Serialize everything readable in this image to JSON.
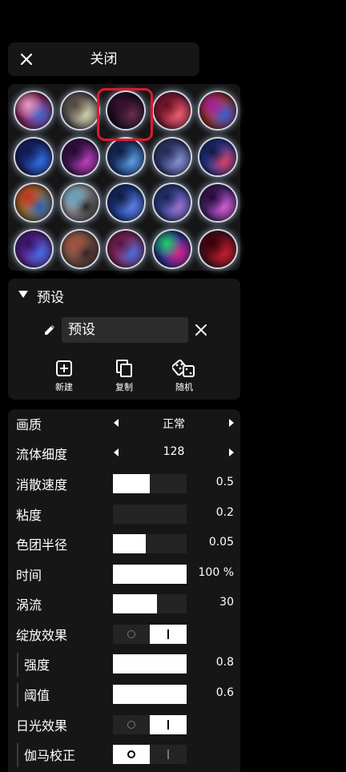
{
  "header": {
    "close_label": "关闭"
  },
  "presets": {
    "selected_index": 2,
    "items": [
      {
        "colors": [
          "#d03080",
          "#3a6ad0",
          "#e0a0c0"
        ]
      },
      {
        "colors": [
          "#8a8070",
          "#d0d0b0",
          "#504840"
        ]
      },
      {
        "colors": [
          "#1a0a18",
          "#6a3050",
          "#3a1030"
        ]
      },
      {
        "colors": [
          "#c02848",
          "#e86070",
          "#601020"
        ]
      },
      {
        "colors": [
          "#e04020",
          "#3060e0",
          "#a020a0"
        ]
      },
      {
        "colors": [
          "#203090",
          "#3070e0",
          "#101850"
        ]
      },
      {
        "colors": [
          "#602070",
          "#c040c0",
          "#200830"
        ]
      },
      {
        "colors": [
          "#2050a0",
          "#60a0e0",
          "#101838"
        ]
      },
      {
        "colors": [
          "#4858a0",
          "#8890d0",
          "#202850"
        ]
      },
      {
        "colors": [
          "#3050d0",
          "#e04060",
          "#101840"
        ]
      },
      {
        "colors": [
          "#e0a030",
          "#2060c0",
          "#c03020"
        ]
      },
      {
        "colors": [
          "#e0e0e0",
          "#202020",
          "#60a0c0"
        ]
      },
      {
        "colors": [
          "#2050c0",
          "#6080e0",
          "#101838"
        ]
      },
      {
        "colors": [
          "#4060c0",
          "#a070d0",
          "#182050"
        ]
      },
      {
        "colors": [
          "#7030a0",
          "#d060d0",
          "#200830"
        ]
      },
      {
        "colors": [
          "#8030c0",
          "#4070e0",
          "#301060"
        ]
      },
      {
        "colors": [
          "#c08060",
          "#302028",
          "#a05040"
        ]
      },
      {
        "colors": [
          "#c03070",
          "#4070e0",
          "#501840"
        ]
      },
      {
        "colors": [
          "#3040d0",
          "#e02080",
          "#20d060"
        ]
      },
      {
        "colors": [
          "#801020",
          "#c02030",
          "#300008"
        ]
      }
    ]
  },
  "preset_panel": {
    "title": "预设",
    "name_value": "预设",
    "actions": [
      {
        "label": "新建",
        "icon": "add-square-icon"
      },
      {
        "label": "复制",
        "icon": "copy-icon"
      },
      {
        "label": "随机",
        "icon": "dice-icon"
      }
    ]
  },
  "settings": {
    "quality": {
      "label": "画质",
      "value": "正常"
    },
    "fluid_detail": {
      "label": "流体细度",
      "value": "128"
    },
    "dissipation": {
      "label": "消散速度",
      "value": "0.5",
      "fill": 0.5
    },
    "viscosity": {
      "label": "粘度",
      "value": "0.2",
      "fill": 0.0
    },
    "splat_radius": {
      "label": "色团半径",
      "value": "0.05",
      "fill": 0.45
    },
    "time": {
      "label": "时间",
      "value": "100 %",
      "fill": 1.0
    },
    "curl": {
      "label": "涡流",
      "value": "30",
      "fill": 0.6
    },
    "bloom": {
      "label": "绽放效果",
      "on": true
    },
    "bloom_intensity": {
      "label": "强度",
      "value": "0.8",
      "fill": 1.0
    },
    "bloom_threshold": {
      "label": "阈值",
      "value": "0.6",
      "fill": 1.0
    },
    "sunrays": {
      "label": "日光效果",
      "on": true
    },
    "gamma": {
      "label": "伽马校正",
      "on": false
    }
  }
}
